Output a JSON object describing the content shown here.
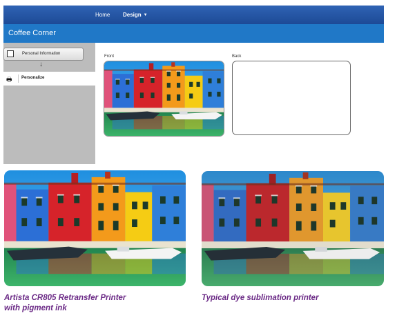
{
  "nav": {
    "home": "Home",
    "design": "Design"
  },
  "app": {
    "title": "Coffee Corner"
  },
  "sidebar": {
    "steps": [
      {
        "label": "Personal Information"
      },
      {
        "label": "Personalize"
      }
    ]
  },
  "cards": {
    "front_label": "Front",
    "back_label": "Back"
  },
  "comparison": {
    "left_caption_line1": "Artista CR805 Retransfer Printer",
    "left_caption_line2": "with pigment ink",
    "right_caption": "Typical dye sublimation printer"
  },
  "colors": {
    "nav": "#1d4a96",
    "appbar": "#2078c7",
    "sidebar": "#bcbcbc",
    "caption": "#6b2a86"
  }
}
